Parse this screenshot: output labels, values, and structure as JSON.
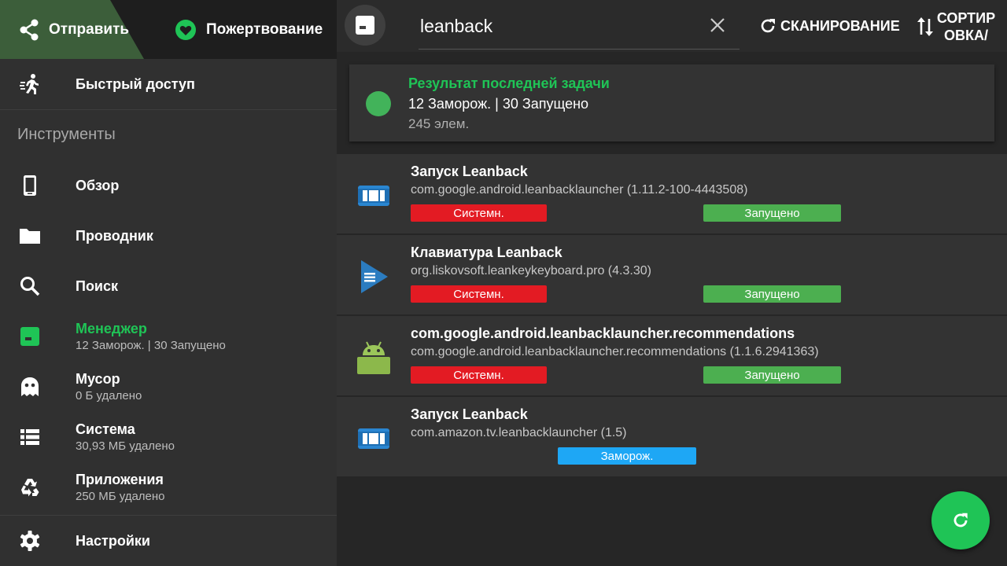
{
  "header": {
    "share_label": "Отправить",
    "donate_label": "Пожертвование"
  },
  "sidebar": {
    "quick_access": "Быстрый доступ",
    "section_title": "Инструменты",
    "items": [
      {
        "label": "Обзор",
        "sub": ""
      },
      {
        "label": "Проводник",
        "sub": ""
      },
      {
        "label": "Поиск",
        "sub": ""
      },
      {
        "label": "Менеджер",
        "sub": "12 Заморож. | 30 Запущено"
      },
      {
        "label": "Мусор",
        "sub": "0 Б удалено"
      },
      {
        "label": "Система",
        "sub": "30,93 МБ удалено"
      },
      {
        "label": "Приложения",
        "sub": "250 МБ удалено"
      }
    ],
    "settings": "Настройки"
  },
  "toolbar": {
    "search_value": "leanback",
    "scan_label": "СКАНИРОВАНИЕ",
    "sort_label_line1": "СОРТИР",
    "sort_label_line2": "ОВКА/"
  },
  "result": {
    "title": "Результат последней задачи",
    "line1": "12 Заморож. | 30 Запущено",
    "line2": "245 элем."
  },
  "apps": [
    {
      "name": "Запуск Leanback",
      "pkg": "com.google.android.leanbacklauncher (1.11.2-100-4443508)",
      "tag1": "Системн.",
      "tag2": "Запущено"
    },
    {
      "name": "Клавиатура Leanback",
      "pkg": "org.liskovsoft.leankeykeyboard.pro (4.3.30)",
      "tag1": "Системн.",
      "tag2": "Запущено"
    },
    {
      "name": "com.google.android.leanbacklauncher.recommendations",
      "pkg": "com.google.android.leanbacklauncher.recommendations (1.1.6.2941363)",
      "tag1": "Системн.",
      "tag2": "Запущено"
    },
    {
      "name": "Запуск Leanback",
      "pkg": "com.amazon.tv.leanbacklauncher (1.5)",
      "tag1": "Заморож."
    }
  ],
  "colors": {
    "accent": "#1fc456",
    "system_tag": "#e31b23",
    "running_tag": "#4caf50",
    "frozen_tag": "#1ea7f5"
  }
}
